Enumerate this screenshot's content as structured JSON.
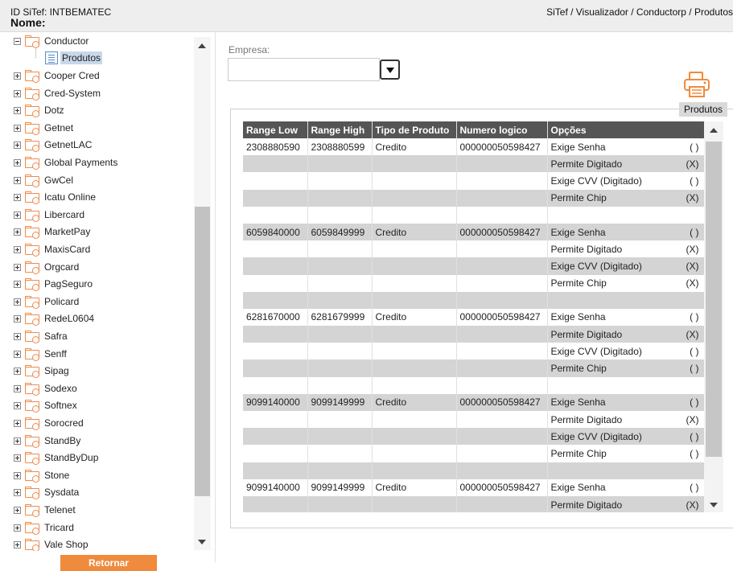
{
  "header": {
    "sitef_id": "ID SiTef: INTBEMATEC",
    "nome": "Nome:",
    "breadcrumb": "SiTef / Visualizador / Conductorp / Produtos"
  },
  "tree": {
    "root": "Conductor",
    "selected_child": "Produtos",
    "items": [
      "Cooper Cred",
      "Cred-System",
      "Dotz",
      "Getnet",
      "GetnetLAC",
      "Global Payments",
      "GwCel",
      "Icatu Online",
      "Libercard",
      "MarketPay",
      "MaxisCard",
      "Orgcard",
      "PagSeguro",
      "Policard",
      "RedeL0604",
      "Safra",
      "Senff",
      "Sipag",
      "Sodexo",
      "Softnex",
      "Sorocred",
      "StandBy",
      "StandByDup",
      "Stone",
      "Sysdata",
      "Telenet",
      "Tricard",
      "Vale Shop"
    ],
    "retornar_label": "Retornar"
  },
  "empresa": {
    "label": "Empresa:",
    "value": ""
  },
  "print": {
    "tab_label": "Produtos",
    "icon": "printer-icon"
  },
  "table": {
    "headers": [
      "Range Low",
      "Range High",
      "Tipo de Produto",
      "Numero logico",
      "Opções"
    ],
    "groups": [
      {
        "range_low": "2308880590",
        "range_high": "2308880599",
        "tipo": "Credito",
        "numero": "000000050598427",
        "options": [
          [
            "Exige Senha",
            "( )"
          ],
          [
            "Permite Digitado",
            "(X)"
          ],
          [
            "Exige CVV (Digitado)",
            "( )"
          ],
          [
            "Permite Chip",
            "(X)"
          ]
        ]
      },
      {
        "range_low": "6059840000",
        "range_high": "6059849999",
        "tipo": "Credito",
        "numero": "000000050598427",
        "options": [
          [
            "Exige Senha",
            "( )"
          ],
          [
            "Permite Digitado",
            "(X)"
          ],
          [
            "Exige CVV (Digitado)",
            "(X)"
          ],
          [
            "Permite Chip",
            "(X)"
          ]
        ]
      },
      {
        "range_low": "6281670000",
        "range_high": "6281679999",
        "tipo": "Credito",
        "numero": "000000050598427",
        "options": [
          [
            "Exige Senha",
            "( )"
          ],
          [
            "Permite Digitado",
            "(X)"
          ],
          [
            "Exige CVV (Digitado)",
            "( )"
          ],
          [
            "Permite Chip",
            "( )"
          ]
        ]
      },
      {
        "range_low": "9099140000",
        "range_high": "9099149999",
        "tipo": "Credito",
        "numero": "000000050598427",
        "options": [
          [
            "Exige Senha",
            "( )"
          ],
          [
            "Permite Digitado",
            "(X)"
          ],
          [
            "Exige CVV (Digitado)",
            "( )"
          ],
          [
            "Permite Chip",
            "( )"
          ]
        ]
      },
      {
        "range_low": "9099140000",
        "range_high": "9099149999",
        "tipo": "Credito",
        "numero": "000000050598427",
        "options": [
          [
            "Exige Senha",
            "( )"
          ],
          [
            "Permite Digitado",
            "(X)"
          ]
        ]
      }
    ]
  },
  "colors": {
    "header_row": "#555555",
    "gray_row": "#d4d4d4",
    "accent": "#f08a3c"
  }
}
